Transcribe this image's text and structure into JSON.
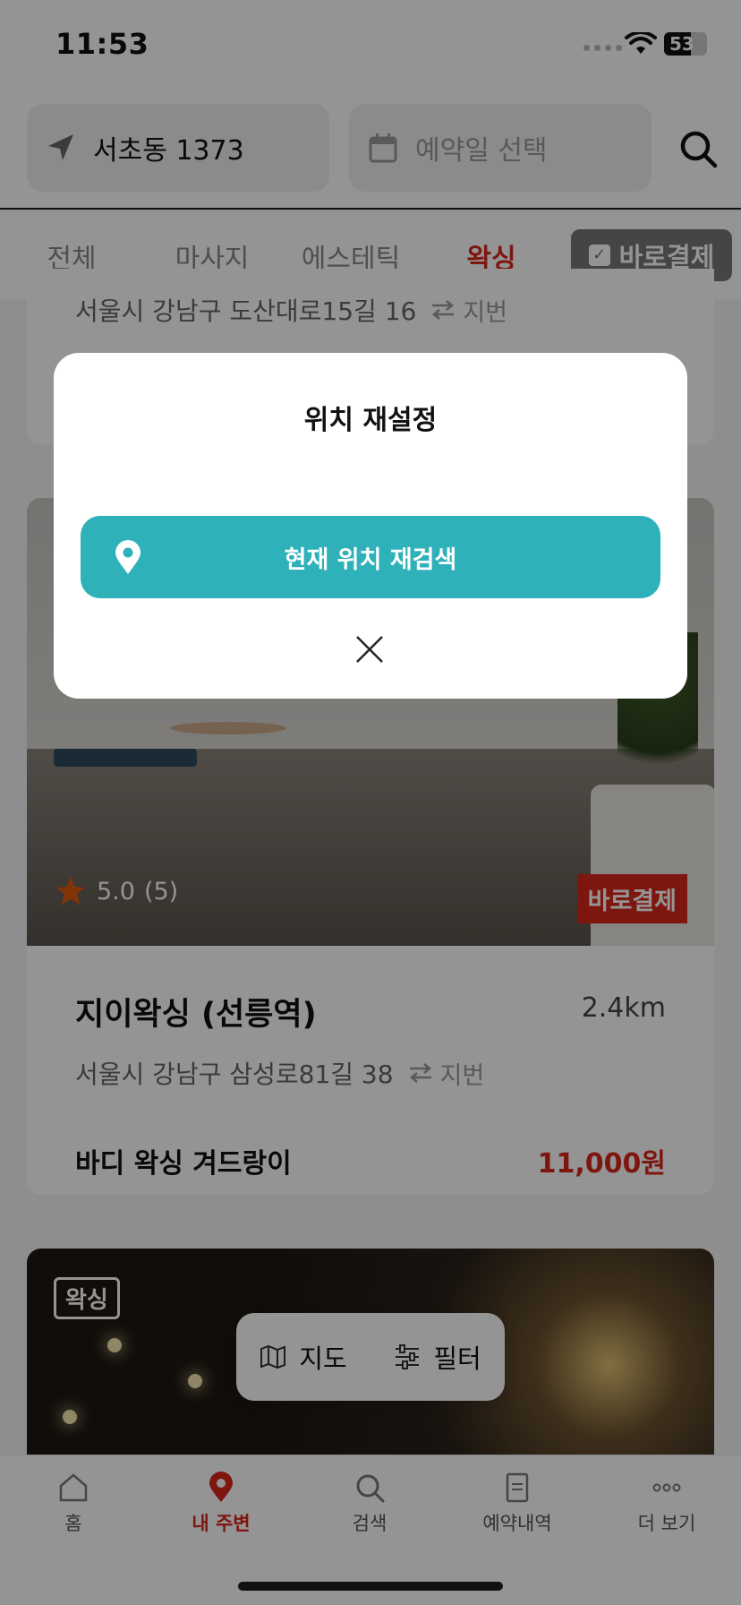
{
  "status_bar": {
    "time": "11:53",
    "battery": "53"
  },
  "search": {
    "location": "서초동 1373",
    "date_placeholder": "예약일 선택"
  },
  "tabs": [
    {
      "label": "전체"
    },
    {
      "label": "마사지"
    },
    {
      "label": "에스테틱"
    },
    {
      "label": "왁싱"
    }
  ],
  "quick_pay_filter": "바로결제",
  "card1": {
    "address": "서울시 강남구 도산대로15길 16",
    "jibun": "지번"
  },
  "card2": {
    "rating": "5.0",
    "review_count": "(5)",
    "badge": "바로결제",
    "name": "지이왁싱 (선릉역)",
    "distance": "2.4km",
    "address": "서울시 강남구 삼성로81길 38",
    "jibun": "지번",
    "service": "바디 왁싱 겨드랑이",
    "price": "11,000원"
  },
  "card3": {
    "category": "왁싱"
  },
  "floating": {
    "map": "지도",
    "filter": "필터"
  },
  "bottom_nav": [
    {
      "label": "홈"
    },
    {
      "label": "내 주변"
    },
    {
      "label": "검색"
    },
    {
      "label": "예약내역"
    },
    {
      "label": "더 보기"
    }
  ],
  "modal": {
    "title": "위치 재설정",
    "button": "현재 위치 재검색"
  },
  "colors": {
    "accent": "#d9261c",
    "teal": "#2eb1b9"
  }
}
